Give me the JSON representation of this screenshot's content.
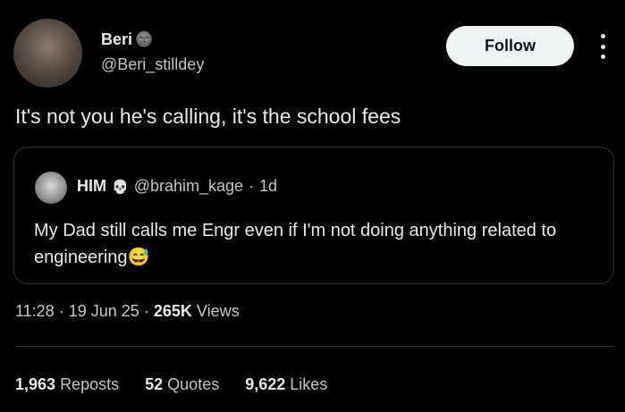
{
  "author": {
    "name": "Beri",
    "badge_emoji": "🌚",
    "handle": "@Beri_stilldey"
  },
  "follow_label": "Follow",
  "tweet": {
    "text": "It's not you he's calling, it's the school fees"
  },
  "quoted": {
    "name": "HIM",
    "name_emoji": "💀",
    "handle": "@brahim_kage",
    "separator": "·",
    "time": "1d",
    "text": "My Dad still calls me Engr even if I'm not doing anything related to engineering😅"
  },
  "meta": {
    "time": "11:28",
    "sep1": "·",
    "date": "19 Jun 25",
    "sep2": "·",
    "views_count": "265K",
    "views_label": "Views"
  },
  "stats": {
    "reposts_count": "1,963",
    "reposts_label": "Reposts",
    "quotes_count": "52",
    "quotes_label": "Quotes",
    "likes_count": "9,622",
    "likes_label": "Likes"
  }
}
